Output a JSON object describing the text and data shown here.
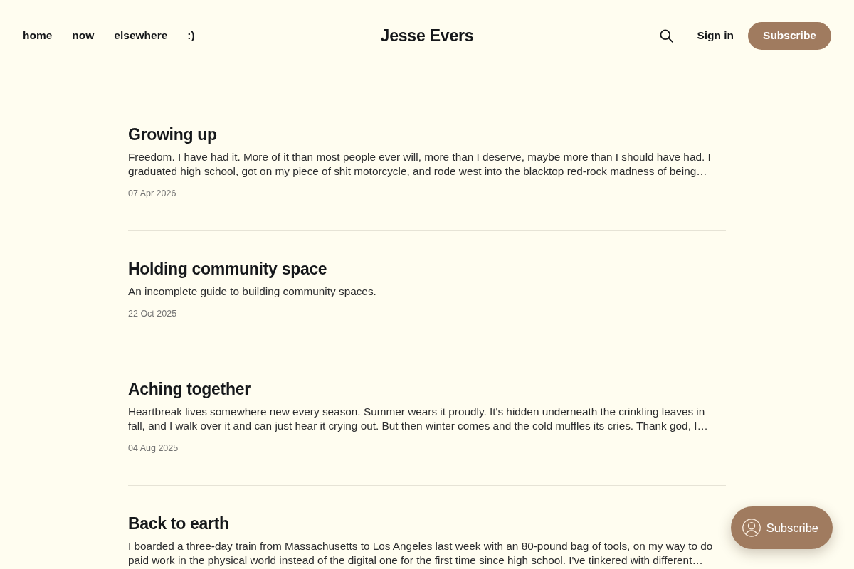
{
  "nav_links": [
    "home",
    "now",
    "elsewhere",
    ":)"
  ],
  "site_title": "Jesse Evers",
  "actions": {
    "sign_in": "Sign in",
    "subscribe": "Subscribe"
  },
  "posts": [
    {
      "title": "Growing up",
      "excerpt": "Freedom. I have had it. More of it than most people ever will, more than I deserve, maybe more than I should have had. I graduated high school, got on my piece of shit motorcycle, and rode west into the blacktop red-rock madness of being…",
      "date": "07 Apr 2026"
    },
    {
      "title": "Holding community space",
      "excerpt": "An incomplete guide to building community spaces.",
      "date": "22 Oct 2025"
    },
    {
      "title": "Aching together",
      "excerpt": "Heartbreak lives somewhere new every season. Summer wears it proudly. It's hidden underneath the crinkling leaves in fall, and I walk over it and can just hear it crying out. But then winter comes and the cold muffles its cries. Thank god, I…",
      "date": "04 Aug 2025"
    },
    {
      "title": "Back to earth",
      "excerpt": "I boarded a three-day train from Massachusetts to Los Angeles last week with an 80-pound bag of tools, on my way to do paid work in the physical world instead of the digital one for the first time since high school. I've tinkered with different…"
    }
  ],
  "floating_button": {
    "label": "Subscribe"
  }
}
